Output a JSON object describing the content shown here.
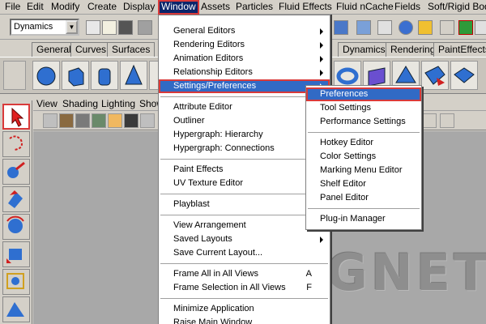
{
  "menubar": {
    "items": [
      "File",
      "Edit",
      "Modify",
      "Create",
      "Display",
      "Window",
      "Assets",
      "Particles",
      "Fluid Effects",
      "Fluid nCache",
      "Fields",
      "Soft/Rigid Bodies"
    ]
  },
  "statusline": {
    "mode": "Dynamics"
  },
  "shelf": {
    "tabs": [
      "General",
      "Curves",
      "Surfaces",
      "Dynamics",
      "Rendering",
      "PaintEffects"
    ]
  },
  "viewport": {
    "menus": [
      "View",
      "Shading",
      "Lighting",
      "Show"
    ],
    "watermark": "GNET"
  },
  "window_menu": {
    "items": [
      {
        "label": "General Editors",
        "submenu": true
      },
      {
        "label": "Rendering Editors",
        "submenu": true
      },
      {
        "label": "Animation Editors",
        "submenu": true
      },
      {
        "label": "Relationship Editors",
        "submenu": true
      },
      {
        "label": "Settings/Preferences",
        "submenu": true,
        "highlighted": true
      },
      {
        "label": "Attribute Editor"
      },
      {
        "label": "Outliner"
      },
      {
        "label": "Hypergraph: Hierarchy"
      },
      {
        "label": "Hypergraph: Connections"
      },
      {
        "label": "Paint Effects"
      },
      {
        "label": "UV Texture Editor"
      },
      {
        "label": "Playblast"
      },
      {
        "label": "View Arrangement",
        "submenu": true
      },
      {
        "label": "Saved Layouts",
        "submenu": true
      },
      {
        "label": "Save Current Layout..."
      },
      {
        "label": "Frame All in All Views",
        "shortcut": "A"
      },
      {
        "label": "Frame Selection in All Views",
        "shortcut": "F"
      },
      {
        "label": "Minimize Application"
      },
      {
        "label": "Raise Main Window"
      }
    ]
  },
  "settings_submenu": {
    "items": [
      {
        "label": "Preferences",
        "highlighted": true
      },
      {
        "label": "Tool Settings"
      },
      {
        "label": "Performance Settings"
      },
      {
        "label": "Hotkey Editor"
      },
      {
        "label": "Color Settings"
      },
      {
        "label": "Marking Menu Editor"
      },
      {
        "label": "Shelf Editor"
      },
      {
        "label": "Panel Editor"
      },
      {
        "label": "Plug-in Manager"
      }
    ]
  },
  "colors": {
    "menu_highlight": "#316ac5",
    "annotation_box": "#d93a3a",
    "menubar_active": "#0a246a"
  }
}
